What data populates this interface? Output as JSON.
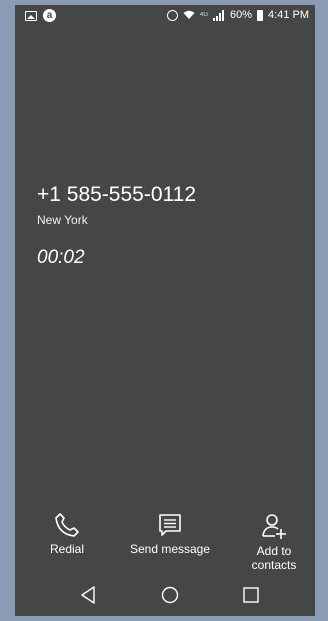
{
  "status_bar": {
    "battery_percent": "60%",
    "time": "4:41 PM",
    "network_label": "4G"
  },
  "call": {
    "number": "+1 585-555-0112",
    "location": "New York",
    "duration": "00:02"
  },
  "actions": {
    "redial_label": "Redial",
    "message_label": "Send message",
    "add_label": "Add to contacts"
  },
  "icons": {
    "redial": "phone-icon",
    "message": "message-icon",
    "add": "add-person-icon",
    "back": "back-icon",
    "home": "home-icon",
    "recents": "recents-icon"
  }
}
